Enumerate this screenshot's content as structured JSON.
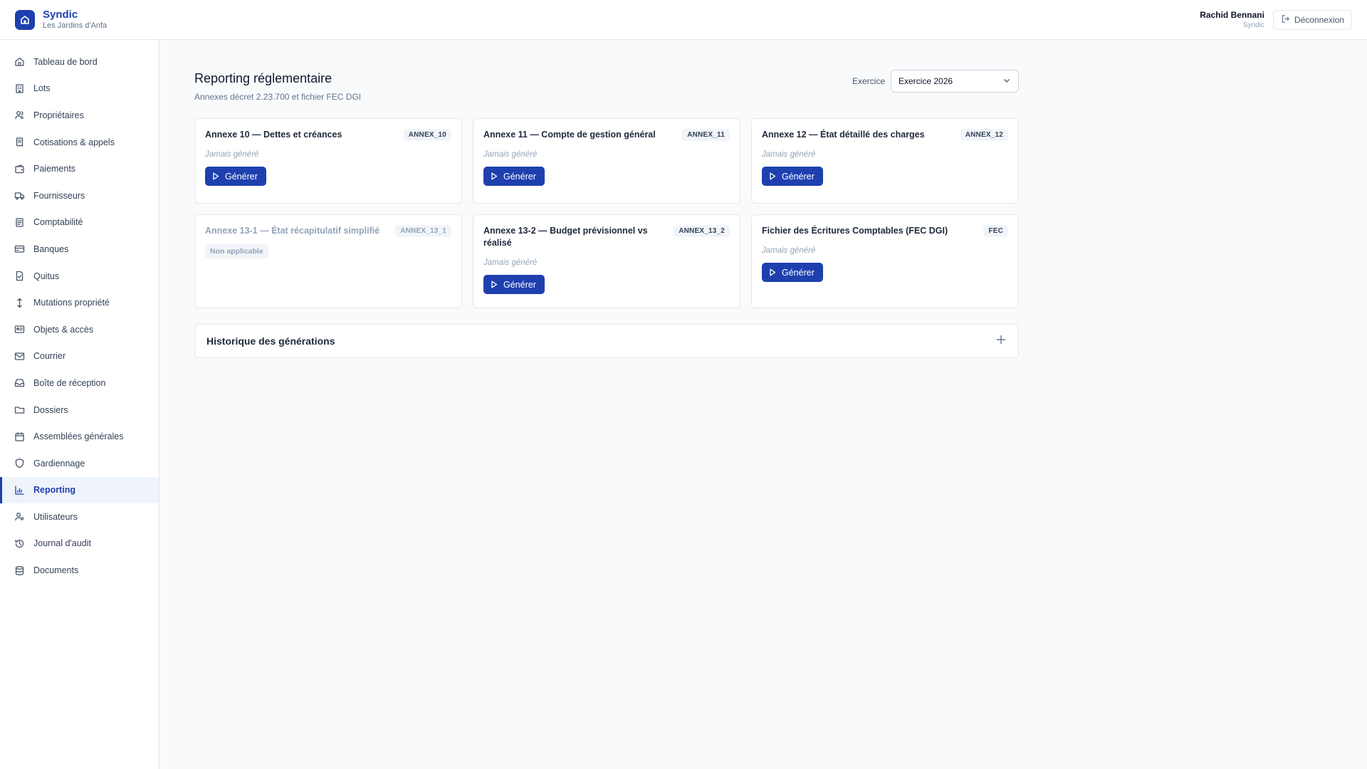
{
  "app": {
    "name": "Syndic",
    "subtitle": "Les Jardins d'Anfa",
    "accent": "#1e40af"
  },
  "user": {
    "name": "Rachid Bennani",
    "role": "Syndic",
    "logout_label": "Déconnexion"
  },
  "sidebar": {
    "items": [
      {
        "label": "Tableau de bord",
        "icon": "home-icon"
      },
      {
        "label": "Lots",
        "icon": "building-icon"
      },
      {
        "label": "Propriétaires",
        "icon": "users-icon"
      },
      {
        "label": "Cotisations & appels",
        "icon": "receipt-icon"
      },
      {
        "label": "Paiements",
        "icon": "wallet-icon"
      },
      {
        "label": "Fournisseurs",
        "icon": "truck-icon"
      },
      {
        "label": "Comptabilité",
        "icon": "ledger-icon"
      },
      {
        "label": "Banques",
        "icon": "credit-card-icon"
      },
      {
        "label": "Quitus",
        "icon": "file-check-icon"
      },
      {
        "label": "Mutations propriété",
        "icon": "arrows-vertical-icon"
      },
      {
        "label": "Objets & accès",
        "icon": "id-card-icon"
      },
      {
        "label": "Courrier",
        "icon": "mail-icon"
      },
      {
        "label": "Boîte de réception",
        "icon": "inbox-icon"
      },
      {
        "label": "Dossiers",
        "icon": "folder-icon"
      },
      {
        "label": "Assemblées générales",
        "icon": "calendar-icon"
      },
      {
        "label": "Gardiennage",
        "icon": "shield-icon"
      },
      {
        "label": "Reporting",
        "icon": "bar-chart-icon",
        "active": true
      },
      {
        "label": "Utilisateurs",
        "icon": "user-cog-icon"
      },
      {
        "label": "Journal d'audit",
        "icon": "history-icon"
      },
      {
        "label": "Documents",
        "icon": "database-icon"
      }
    ]
  },
  "page": {
    "title": "Reporting réglementaire",
    "subtitle": "Annexes décret 2.23.700 et fichier FEC DGI",
    "exercice_label": "Exercice",
    "exercice_value": "Exercice 2026"
  },
  "cards": [
    {
      "title": "Annexe 10 — Dettes et créances",
      "code": "ANNEX_10",
      "status": "Jamais généré",
      "button": "Générer"
    },
    {
      "title": "Annexe 11 — Compte de gestion général",
      "code": "ANNEX_11",
      "status": "Jamais généré",
      "button": "Générer"
    },
    {
      "title": "Annexe 12 — État détaillé des charges",
      "code": "ANNEX_12",
      "status": "Jamais généré",
      "button": "Générer"
    },
    {
      "title": "Annexe 13-1 — État récapitulatif simplifié",
      "code": "ANNEX_13_1",
      "badge": "Non applicable"
    },
    {
      "title": "Annexe 13-2 — Budget prévisionnel vs réalisé",
      "code": "ANNEX_13_2",
      "status": "Jamais généré",
      "button": "Générer"
    },
    {
      "title": "Fichier des Écritures Comptables (FEC DGI)",
      "code": "FEC",
      "status": "Jamais généré",
      "button": "Générer"
    }
  ],
  "history": {
    "title": "Historique des générations"
  }
}
